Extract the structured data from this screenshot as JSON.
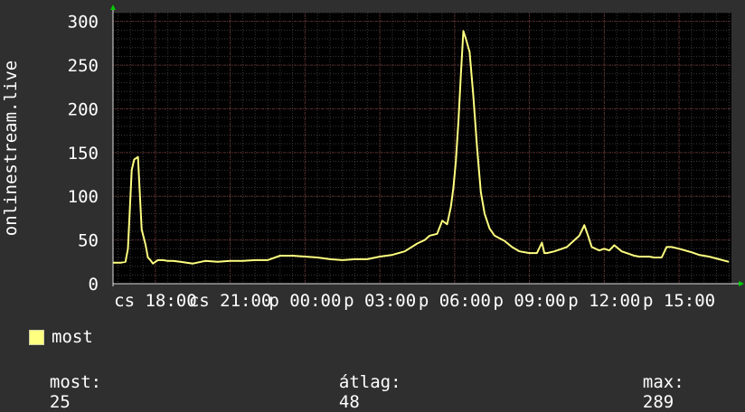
{
  "chart_data": {
    "type": "line",
    "ylabel": "onlinestream.live",
    "ylim": [
      0,
      310
    ],
    "yticks": [
      0,
      50,
      100,
      150,
      200,
      250,
      300
    ],
    "xlim": [
      16.3,
      41.1
    ],
    "xticks": [
      {
        "x": 18,
        "label": "cs 18:00"
      },
      {
        "x": 21,
        "label": "cs 21:00"
      },
      {
        "x": 24,
        "label": "p 00:00"
      },
      {
        "x": 27,
        "label": "p 03:00"
      },
      {
        "x": 30,
        "label": "p 06:00"
      },
      {
        "x": 33,
        "label": "p 09:00"
      },
      {
        "x": 36,
        "label": "p 12:00"
      },
      {
        "x": 39,
        "label": "p 15:00"
      }
    ],
    "grid": true,
    "legend_position": "bottom-left",
    "series": [
      {
        "name": "most",
        "color": "#ffff80",
        "x": [
          16.3,
          16.6,
          16.8,
          16.9,
          17.05,
          17.15,
          17.3,
          17.45,
          17.6,
          17.7,
          17.8,
          17.9,
          18.1,
          18.3,
          18.5,
          18.7,
          19.0,
          19.5,
          20.0,
          20.5,
          21.0,
          21.5,
          22.0,
          22.5,
          23.0,
          23.5,
          24.0,
          24.5,
          25.0,
          25.5,
          26.0,
          26.5,
          27.0,
          27.5,
          28.0,
          28.5,
          28.8,
          29.0,
          29.3,
          29.5,
          29.7,
          29.85,
          29.95,
          30.05,
          30.15,
          30.25,
          30.35,
          30.45,
          30.6,
          30.75,
          30.9,
          31.05,
          31.2,
          31.4,
          31.6,
          31.8,
          32.0,
          32.3,
          32.6,
          33.0,
          33.3,
          33.5,
          33.6,
          33.7,
          34.0,
          34.5,
          35.0,
          35.2,
          35.35,
          35.5,
          35.8,
          36.0,
          36.2,
          36.4,
          36.7,
          37.0,
          37.2,
          37.4,
          37.8,
          38.0,
          38.3,
          38.5,
          38.7,
          39.0,
          39.5,
          39.8,
          40.2,
          40.6,
          41.0
        ],
        "values": [
          24,
          24,
          25,
          40,
          130,
          142,
          145,
          62,
          45,
          30,
          27,
          23,
          27,
          27,
          26,
          26,
          25,
          23,
          26,
          25,
          26,
          26,
          27,
          27,
          32,
          32,
          31,
          30,
          28,
          27,
          28,
          28,
          31,
          33,
          37,
          46,
          50,
          55,
          57,
          72,
          68,
          88,
          110,
          140,
          185,
          240,
          289,
          280,
          265,
          215,
          155,
          105,
          80,
          63,
          55,
          52,
          49,
          42,
          37,
          35,
          35,
          47,
          35,
          35,
          37,
          42,
          55,
          67,
          55,
          42,
          38,
          40,
          38,
          44,
          37,
          34,
          32,
          31,
          31,
          30,
          30,
          42,
          42,
          40,
          36,
          33,
          31,
          28,
          25
        ]
      }
    ],
    "stats": [
      {
        "label": "most:",
        "value": "25"
      },
      {
        "label": "átlag:",
        "value": "48"
      },
      {
        "label": "max:",
        "value": "289"
      }
    ]
  }
}
